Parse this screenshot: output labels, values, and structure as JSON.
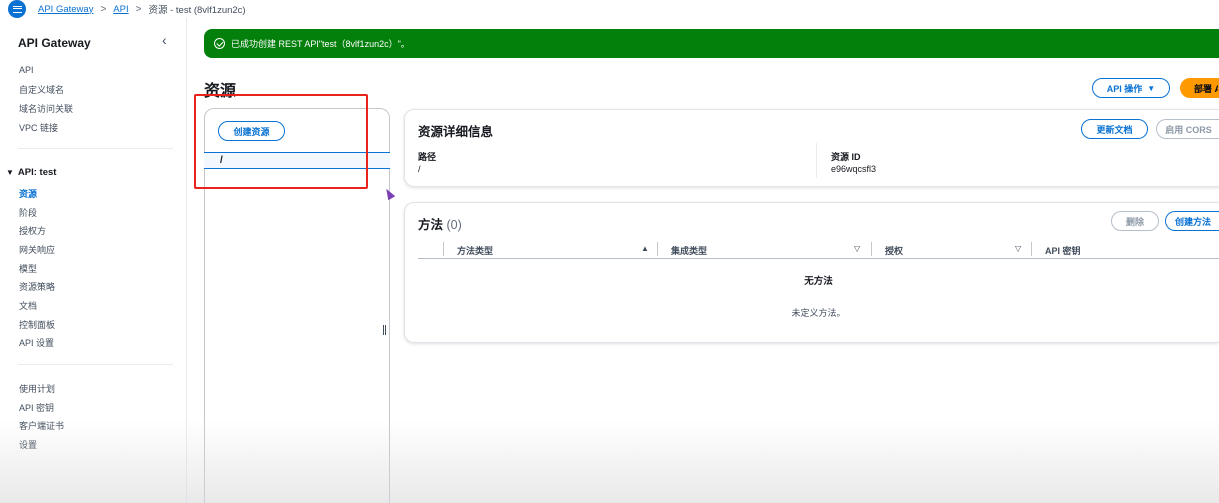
{
  "breadcrumb": {
    "items": [
      "API Gateway",
      "API",
      "资源 - test (8vlf1zun2c)"
    ]
  },
  "sidebar": {
    "title": "API Gateway",
    "top_items": [
      "API",
      "自定义域名",
      "域名访问关联",
      "VPC 链接"
    ],
    "section_title": "API: test",
    "api_items": [
      "资源",
      "阶段",
      "授权方",
      "网关响应",
      "模型",
      "资源策略",
      "文档",
      "控制面板",
      "API 设置"
    ],
    "bottom_items": [
      "使用计划",
      "API 密钥",
      "客户端证书",
      "设置"
    ]
  },
  "flash": {
    "message": "已成功创建 REST API\"test（8vlf1zun2c）\"。"
  },
  "page": {
    "title": "资源",
    "api_actions_label": "API 操作",
    "deploy_label": "部署 API"
  },
  "tree": {
    "create_resource_label": "创建资源",
    "root_path": "/"
  },
  "details": {
    "title": "资源详细信息",
    "update_docs_label": "更新文档",
    "enable_cors_label": "启用 CORS",
    "path_label": "路径",
    "path_value": "/",
    "resource_id_label": "资源 ID",
    "resource_id_value": "e96wqcsfl3"
  },
  "methods": {
    "title": "方法",
    "count": "(0)",
    "delete_label": "删除",
    "create_method_label": "创建方法",
    "columns": [
      "方法类型",
      "集成类型",
      "授权",
      "API 密钥"
    ],
    "empty_title": "无方法",
    "empty_desc": "未定义方法。"
  },
  "colors": {
    "accent": "#0972d3",
    "success": "#037f0c",
    "deploy": "#ff9900",
    "highlight_box": "#e8231c"
  }
}
